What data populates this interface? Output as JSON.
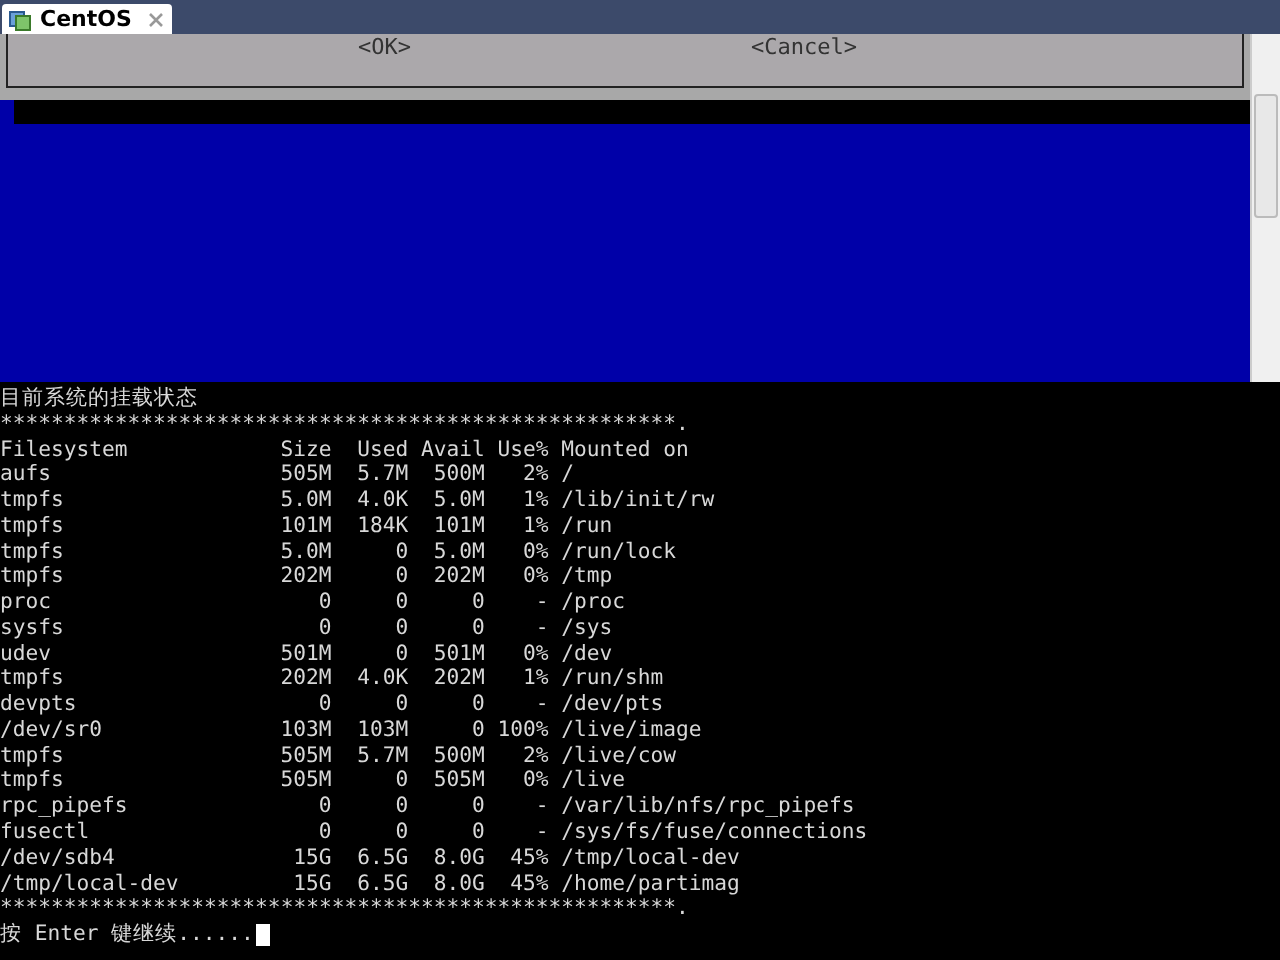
{
  "tab": {
    "title": "CentOS",
    "selected": true
  },
  "dialog": {
    "buttons": [
      "<OK>",
      "<Cancel>"
    ]
  },
  "terminal": {
    "heading": "目前系统的挂载状态",
    "separator_top": "*****************************************************.",
    "columns": [
      "Filesystem",
      "Size",
      "Used",
      "Avail",
      "Use%",
      "Mounted on"
    ],
    "rows": [
      [
        "aufs",
        "505M",
        "5.7M",
        "500M",
        "2%",
        "/"
      ],
      [
        "tmpfs",
        "5.0M",
        "4.0K",
        "5.0M",
        "1%",
        "/lib/init/rw"
      ],
      [
        "tmpfs",
        "101M",
        "184K",
        "101M",
        "1%",
        "/run"
      ],
      [
        "tmpfs",
        "5.0M",
        "0",
        "5.0M",
        "0%",
        "/run/lock"
      ],
      [
        "tmpfs",
        "202M",
        "0",
        "202M",
        "0%",
        "/tmp"
      ],
      [
        "proc",
        "0",
        "0",
        "0",
        "-",
        "/proc"
      ],
      [
        "sysfs",
        "0",
        "0",
        "0",
        "-",
        "/sys"
      ],
      [
        "udev",
        "501M",
        "0",
        "501M",
        "0%",
        "/dev"
      ],
      [
        "tmpfs",
        "202M",
        "4.0K",
        "202M",
        "1%",
        "/run/shm"
      ],
      [
        "devpts",
        "0",
        "0",
        "0",
        "-",
        "/dev/pts"
      ],
      [
        "/dev/sr0",
        "103M",
        "103M",
        "0",
        "100%",
        "/live/image"
      ],
      [
        "tmpfs",
        "505M",
        "5.7M",
        "500M",
        "2%",
        "/live/cow"
      ],
      [
        "tmpfs",
        "505M",
        "0",
        "505M",
        "0%",
        "/live"
      ],
      [
        "rpc_pipefs",
        "0",
        "0",
        "0",
        "-",
        "/var/lib/nfs/rpc_pipefs"
      ],
      [
        "fusectl",
        "0",
        "0",
        "0",
        "-",
        "/sys/fs/fuse/connections"
      ],
      [
        "/dev/sdb4",
        "15G",
        "6.5G",
        "8.0G",
        "45%",
        "/tmp/local-dev"
      ],
      [
        "/tmp/local-dev",
        "15G",
        "6.5G",
        "8.0G",
        "45%",
        "/home/partimag"
      ]
    ],
    "separator_bottom": "*****************************************************.",
    "prompt": "按 Enter 键继续......"
  }
}
